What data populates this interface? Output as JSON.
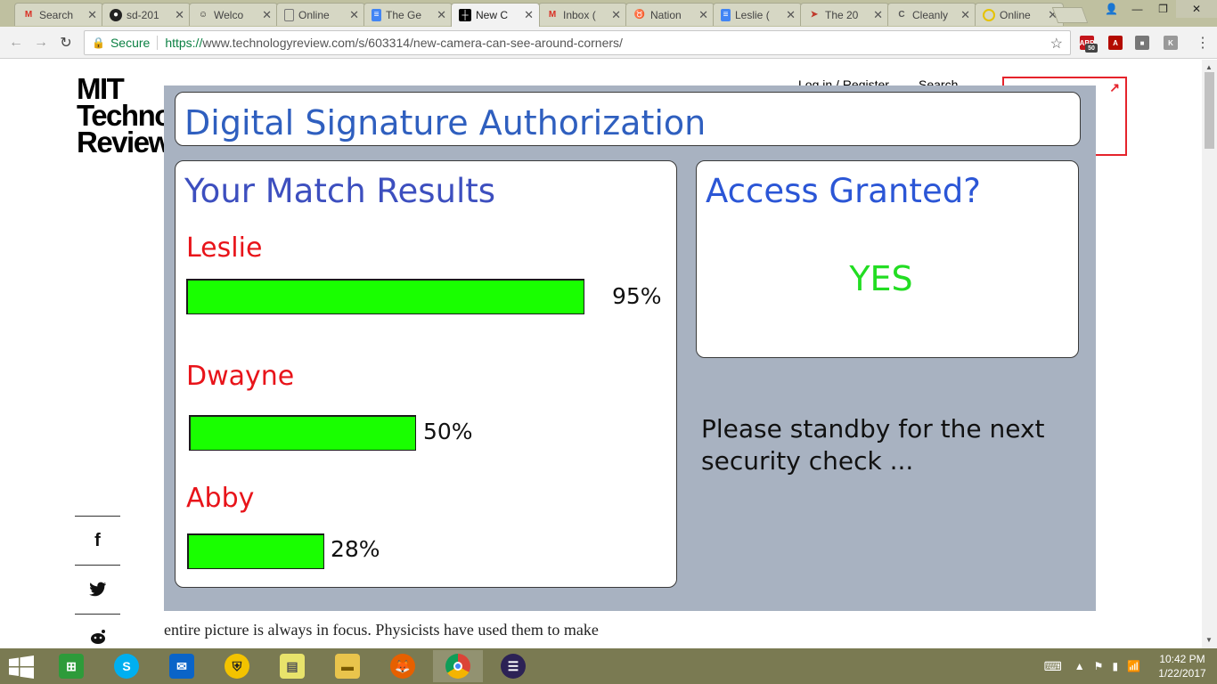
{
  "browser": {
    "tabs": [
      {
        "label": "Search",
        "favicon": "gmail-icon",
        "color": "#d93025"
      },
      {
        "label": "sd-201",
        "favicon": "github-icon",
        "color": "#222222"
      },
      {
        "label": "Welco",
        "favicon": "smiley-icon",
        "color": "#222222"
      },
      {
        "label": "Online",
        "favicon": "page-icon",
        "color": "#777777"
      },
      {
        "label": "The Ge",
        "favicon": "docs-icon",
        "color": "#4285f4"
      },
      {
        "label": "New C",
        "favicon": "mit-tr-icon",
        "color": "#000000"
      },
      {
        "label": "Inbox (",
        "favicon": "gmail-icon",
        "color": "#d93025"
      },
      {
        "label": "Nation",
        "favicon": "nation-icon",
        "color": "#2b8fd6"
      },
      {
        "label": "Leslie (",
        "favicon": "docs-icon",
        "color": "#4285f4"
      },
      {
        "label": "The 20",
        "favicon": "arrow-icon",
        "color": "#c0392b"
      },
      {
        "label": "Cleanly",
        "favicon": "c-icon",
        "color": "#555555"
      },
      {
        "label": "Online",
        "favicon": "coin-icon",
        "color": "#e6c200"
      }
    ],
    "secure_label": "Secure",
    "url_scheme": "https://",
    "url_rest": "www.technologyreview.com/s/603314/new-camera-can-see-around-corners/",
    "adblock_count": "50"
  },
  "page": {
    "logo_line1": "MIT",
    "logo_line2": "Techno",
    "logo_line3": "Review",
    "login_link": "Log in / Register",
    "search_link": "Search",
    "article_text_line": "entire picture is always in focus. Physicists have used them to make"
  },
  "overlay": {
    "title": "Digital Signature Authorization",
    "match_heading": "Your Match Results",
    "matches": [
      {
        "name": "Leslie",
        "percent_label": "95%",
        "percent": 95
      },
      {
        "name": "Dwayne",
        "percent_label": "50%",
        "percent": 50
      },
      {
        "name": "Abby",
        "percent_label": "28%",
        "percent": 28
      }
    ],
    "access_heading": "Access Granted?",
    "access_result": "YES",
    "standby_text": "Please standby for the next security check ..."
  },
  "taskbar": {
    "time": "10:42 PM",
    "date": "1/22/2017"
  },
  "colors": {
    "title_blue": "#2f5fbf",
    "name_red": "#e8141a",
    "bar_green": "#19ff00",
    "yes_green": "#22dd22",
    "overlay_bg": "#a8b2c1"
  }
}
